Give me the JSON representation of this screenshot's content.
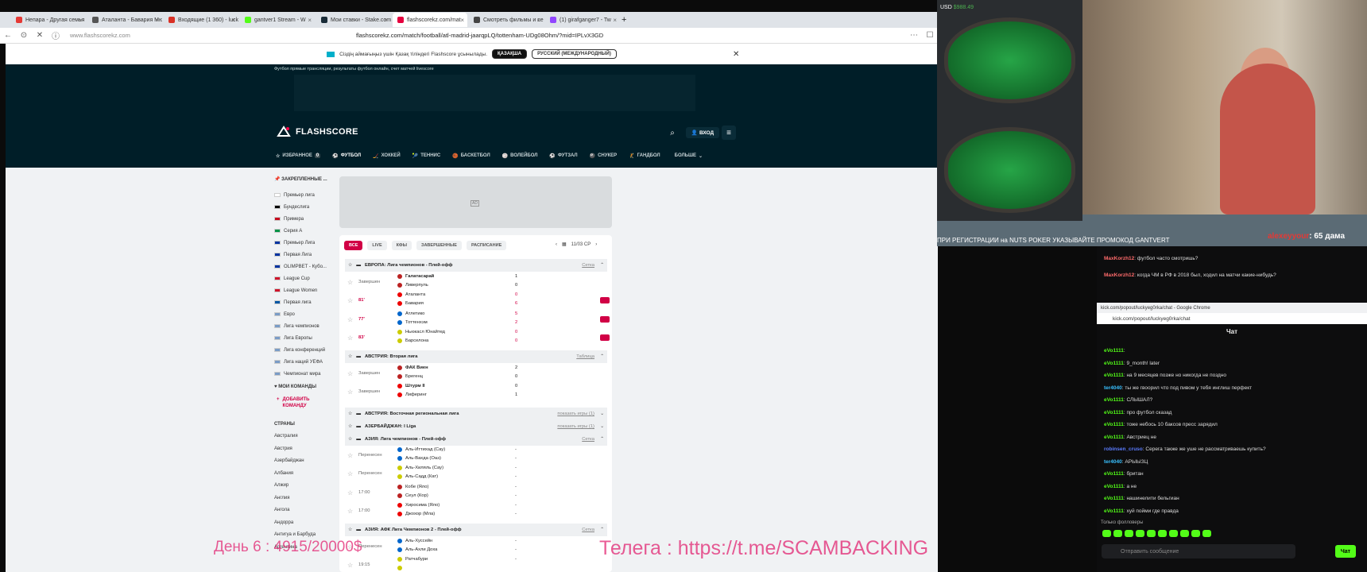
{
  "browser": {
    "tabs": [
      {
        "label": "Непара - Другая семья (",
        "color": "#e53935"
      },
      {
        "label": "Аталанта - Бавария Мюн",
        "color": "#555"
      },
      {
        "label": "Входящие (1 360) - lucky",
        "color": "#d93025"
      },
      {
        "label": "gantver1 Stream - W",
        "color": "#53fc18"
      },
      {
        "label": "Мои ставки - Stake.com",
        "color": "#1a2c38"
      },
      {
        "label": "flashscorekz.com/mat",
        "color": "#e5003e"
      },
      {
        "label": "Смотреть фильмы и сер",
        "color": "#444"
      },
      {
        "label": "(1) girafganger7 - Tw",
        "color": "#9146ff"
      }
    ],
    "url_domain": "www.flashscorekz.com",
    "url_full": "flashscorekz.com/match/football/atl-madrid-jaarqpLQ/tottenham-UDg08Ohm/?mid=IPLvX3GD"
  },
  "notice": {
    "text": "Сіздің аймағыңыз үшін Қазақ тіліндегі Flashscore ұсынылады.",
    "btn1": "ҚАЗАҚША",
    "btn2": "РУССКИЙ (МЕЖДУНАРОДНЫЙ)"
  },
  "site": {
    "subtitle": "Футбол прямые трансляции, результаты футбол онлайн, счет матчей livescore",
    "logo": "FLASHSCORE",
    "login": "ВХОД",
    "nav": [
      {
        "label": "ИЗБРАННОЕ",
        "badge": "0"
      },
      {
        "label": "ФУТБОЛ"
      },
      {
        "label": "ХОККЕЙ"
      },
      {
        "label": "ТЕННИС"
      },
      {
        "label": "БАСКЕТБОЛ"
      },
      {
        "label": "ВОЛЕЙБОЛ"
      },
      {
        "label": "ФУТЗАЛ"
      },
      {
        "label": "СНУКЕР"
      },
      {
        "label": "ГАНДБОЛ"
      },
      {
        "label": "БОЛЬШЕ"
      }
    ]
  },
  "sidebar": {
    "pinned_title": "ЗАКРЕПЛЕННЫЕ ...",
    "leagues": [
      {
        "label": "Премьер лига",
        "flag": "#ffffff"
      },
      {
        "label": "Бундеслига",
        "flag": "#000000"
      },
      {
        "label": "Примера",
        "flag": "#c60b1e"
      },
      {
        "label": "Серия А",
        "flag": "#009246"
      },
      {
        "label": "Премьер Лига",
        "flag": "#0033a0"
      },
      {
        "label": "Первая Лига",
        "flag": "#0033a0"
      },
      {
        "label": "OLIMPBET - Кубо...",
        "flag": "#0033a0"
      },
      {
        "label": "League Cup",
        "flag": "#cf142b"
      },
      {
        "label": "League Women",
        "flag": "#cf142b"
      },
      {
        "label": "Первая лига",
        "flag": "#0055a4"
      },
      {
        "label": "Евро",
        "flag": "#7a9cc6"
      },
      {
        "label": "Лига чемпионов",
        "flag": "#7a9cc6"
      },
      {
        "label": "Лига Европы",
        "flag": "#7a9cc6"
      },
      {
        "label": "Лига конференций",
        "flag": "#7a9cc6"
      },
      {
        "label": "Лига наций УЕФА",
        "flag": "#7a9cc6"
      },
      {
        "label": "Чемпионат мира",
        "flag": "#7a9cc6"
      }
    ],
    "my_teams": "МОИ КОМАНДЫ",
    "add_team": "ДОБАВИТЬ КОМАНДУ",
    "countries_title": "СТРАНЫ",
    "countries": [
      "Австралия",
      "Австрия",
      "Азербайджан",
      "Албания",
      "Алжир",
      "Англия",
      "Ангола",
      "Андорра",
      "Антигуа и Барбуда",
      "Аргентина"
    ]
  },
  "ad_label": "AD",
  "filters": [
    "ВСЕ",
    "LIVE",
    "КФЫ",
    "ЗАВЕРШЕННЫЕ",
    "РАСПИСАНИЕ"
  ],
  "date": "11/03 СР",
  "competitions": [
    {
      "name": "ЕВРОПА: Лига чемпионов - Плей-офф",
      "link": "Сетка"
    },
    {
      "name": "АВСТРИЯ: Вторая лига",
      "link": "Таблица"
    },
    {
      "name": "АВСТРИЯ: Восточная региональная лига",
      "link": "показать игры (1)"
    },
    {
      "name": "АЗЕРБАЙДЖАН: I Liga",
      "link": "показать игры (1)"
    },
    {
      "name": "АЗИЯ: Лига чемпионов - Плей-офф",
      "link": "Сетка"
    },
    {
      "name": "АЗИЯ: АФК Лига Чемпионов 2 - Плей-офф",
      "link": "Сетка"
    }
  ],
  "matches": [
    {
      "status": "Завершен",
      "home": "Галатасарай",
      "away": "Ливерпуль",
      "hs": "1",
      "as": "0",
      "live": false
    },
    {
      "status": "81'",
      "home": "Аталанта",
      "away": "Бавария",
      "hs": "0",
      "as": "6",
      "live": true
    },
    {
      "status": "77'",
      "home": "Атлетико",
      "away": "Тоттенхэм",
      "hs": "5",
      "as": "2",
      "live": true
    },
    {
      "status": "83'",
      "home": "Ньюкасл Юнайтед",
      "away": "Барселона",
      "hs": "0",
      "as": "0",
      "live": true
    },
    {
      "status": "Завершен",
      "home": "ФАК Виен",
      "away": "Брегенц",
      "hs": "2",
      "as": "0",
      "live": false
    },
    {
      "status": "Завершен",
      "home": "Штурм II",
      "away": "Лиферинг",
      "hs": "0",
      "as": "1",
      "live": false
    },
    {
      "status": "Перенесен",
      "home": "Аль-Иттихад (Сау)",
      "away": "Аль-Вахда (Оаэ)",
      "hs": "-",
      "as": "-",
      "live": false
    },
    {
      "status": "Перенесен",
      "home": "Аль-Хиляль (Сау)",
      "away": "Аль-Садд (Кат)",
      "hs": "-",
      "as": "-",
      "live": false
    },
    {
      "status": "17:00",
      "home": "Кобе (Яло)",
      "away": "Сеул (Кор)",
      "hs": "-",
      "as": "-",
      "live": false
    },
    {
      "status": "17:00",
      "home": "Хиросима (Яло)",
      "away": "Джохор (Мла)",
      "hs": "-",
      "as": "-",
      "live": false
    },
    {
      "status": "Перенесен",
      "home": "Аль-Хуссейн",
      "away": "Аль-Ахли Доха",
      "hs": "-",
      "as": "-",
      "live": false
    },
    {
      "status": "19:15",
      "home": "Ратчабури",
      "away": "",
      "hs": "-",
      "as": "",
      "live": false
    }
  ],
  "overlay": {
    "left": "День 6 : 4915/20000$",
    "right": "Телега : https://t.me/SCAMBACKING"
  },
  "stream": {
    "balance": "$988.49",
    "currency": "USD",
    "promo": "ПРИ РЕГИСТРАЦИИ на NUTS POKER УКАЗЫВАЙТЕ ПРОМОКОД GANTVERT",
    "donor_name": "alexeyyour",
    "donor_text": ": 65 дама"
  },
  "chat": {
    "top_messages": [
      {
        "user": "MaxKorzh12",
        "text": "футбол часто смотришь?",
        "color": "#ff6b6b"
      },
      {
        "user": "MaxKorzh12",
        "text": "когда ЧМ в РФ в 2018 был, ходил на матчи какие-нибудь?",
        "color": "#ff6b6b"
      }
    ],
    "popup_title": "kick.com/popout/luckyeg0rka/chat - Google Chrome",
    "popup_url": "kick.com/popout/luckyeg0rka/chat",
    "title": "Чат",
    "messages": [
      {
        "user": "eVo1111",
        "text": "",
        "color": "#53fc18"
      },
      {
        "user": "eVo1111",
        "text": "9_month! later",
        "color": "#53fc18"
      },
      {
        "user": "eVo1111",
        "text": "на 9 месяцев позже но никогда не поздно",
        "color": "#53fc18"
      },
      {
        "user": "ter4040",
        "text": "ты же гвоорил что под пивом у тебя инглиш перфект",
        "color": "#39c0ff"
      },
      {
        "user": "eVo1111",
        "text": "СЛЫШАЛ?",
        "color": "#53fc18"
      },
      {
        "user": "eVo1111",
        "text": "про футбол сказад",
        "color": "#53fc18"
      },
      {
        "user": "eVo1111",
        "text": "тоже небось 10 баксов пресс зарядил",
        "color": "#53fc18"
      },
      {
        "user": "eVo1111",
        "text": "Австриец не",
        "color": "#53fc18"
      },
      {
        "user": "robinsen_cruso",
        "text": "Серега также же уше не рассматриваешь купить?",
        "color": "#5b7cff"
      },
      {
        "user": "ter4040",
        "text": "АРЫЫЗЦ",
        "color": "#39c0ff"
      },
      {
        "user": "eVo1111",
        "text": "британ",
        "color": "#53fc18"
      },
      {
        "user": "eVo1111",
        "text": "а не",
        "color": "#53fc18"
      },
      {
        "user": "eVo1111",
        "text": "нашинелити бельгиан",
        "color": "#53fc18"
      },
      {
        "user": "eVo1111",
        "text": "хуй пойми где правда",
        "color": "#53fc18"
      }
    ],
    "followers_only": "Только фолловеры",
    "input_placeholder": "Отправить сообщение",
    "send": "Чат",
    "viewers": "0"
  }
}
